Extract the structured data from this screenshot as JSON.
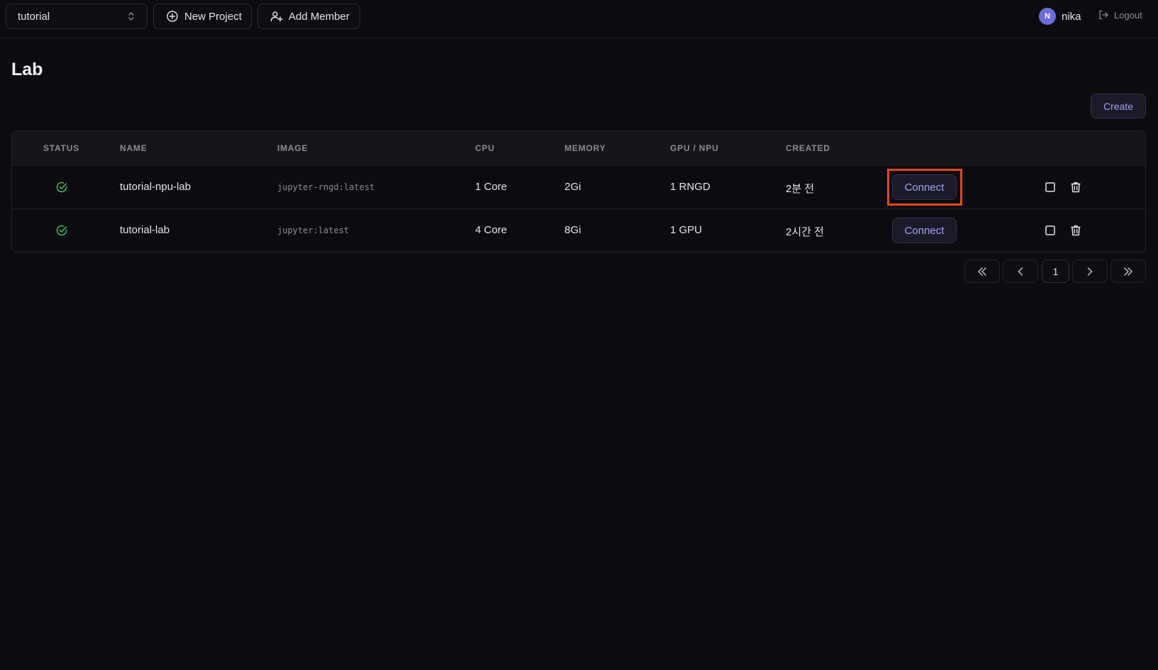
{
  "topbar": {
    "project": {
      "value": "tutorial",
      "icon": "chevron-up-down-icon"
    },
    "new_project_label": "New Project",
    "add_member_label": "Add Member",
    "user": {
      "initial": "N",
      "name": "nika",
      "avatar_color": "#6f6ed6"
    },
    "logout_label": "Logout"
  },
  "page": {
    "title": "Lab",
    "create_label": "Create"
  },
  "table": {
    "headers": {
      "status": "STATUS",
      "name": "NAME",
      "image": "IMAGE",
      "cpu": "CPU",
      "memory": "MEMORY",
      "gpu": "GPU / NPU",
      "created": "CREATED"
    },
    "rows": [
      {
        "status": "running",
        "name": "tutorial-npu-lab",
        "image": "jupyter-rngd:latest",
        "cpu": "1 Core",
        "memory": "2Gi",
        "gpu": "1 RNGD",
        "created": "2분 전",
        "connect_label": "Connect",
        "highlighted": true
      },
      {
        "status": "running",
        "name": "tutorial-lab",
        "image": "jupyter:latest",
        "cpu": "4 Core",
        "memory": "8Gi",
        "gpu": "1 GPU",
        "created": "2시간 전",
        "connect_label": "Connect",
        "highlighted": false
      }
    ]
  },
  "pagination": {
    "current_page": "1"
  },
  "colors": {
    "accent": "#a6a6f2",
    "status_ok": "#3fbf5f",
    "highlight": "#e5461f"
  }
}
